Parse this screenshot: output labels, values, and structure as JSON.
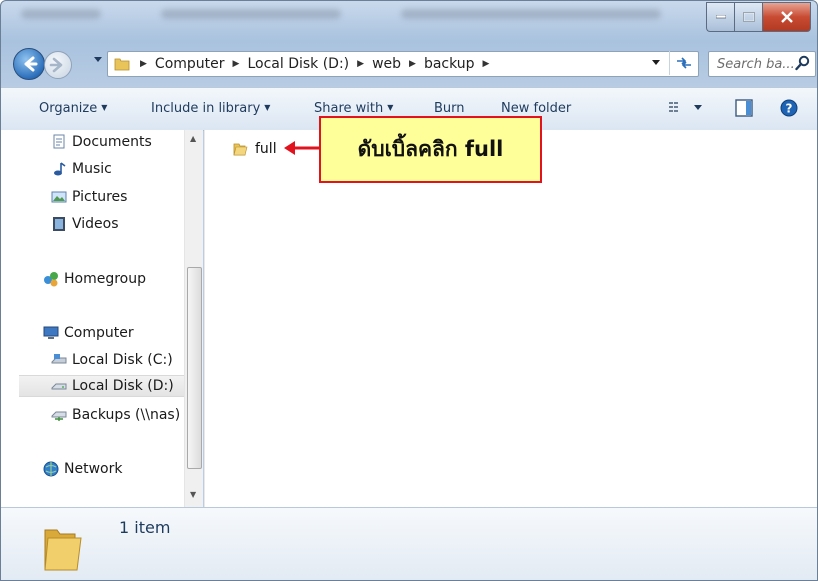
{
  "window": {
    "caption_buttons": [
      "minimize-icon",
      "maximize-icon",
      "close-icon"
    ]
  },
  "address_bar": {
    "path": [
      "Computer",
      "Local Disk (D:)",
      "web",
      "backup"
    ],
    "search_placeholder": "Search ba..."
  },
  "command_bar": {
    "organize": "Organize",
    "include_in_library": "Include in library",
    "share_with": "Share with",
    "burn": "Burn",
    "new_folder": "New folder"
  },
  "nav_pane": {
    "libraries": [
      "Documents",
      "Music",
      "Pictures",
      "Videos"
    ],
    "homegroup": "Homegroup",
    "computer": "Computer",
    "drives": [
      "Local Disk (C:)",
      "Local Disk (D:)",
      "Backups (\\\\nas)"
    ],
    "network": "Network",
    "selected": "Local Disk (D:)"
  },
  "content": {
    "items": [
      {
        "name": "full",
        "type": "folder"
      }
    ]
  },
  "annotation": {
    "text": "ดับเบิ้ลคลิก full",
    "bg_color": "#ffff99",
    "border_color": "#e0131f"
  },
  "details_pane": {
    "count_text": "1 item"
  }
}
